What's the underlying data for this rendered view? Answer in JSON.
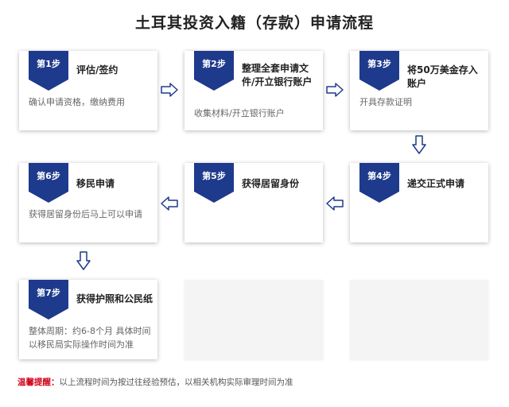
{
  "title": "土耳其投资入籍（存款）申请流程",
  "steps": [
    {
      "badge": "第1步",
      "title": "评估/签约",
      "desc": "确认申请资格，缴纳费用"
    },
    {
      "badge": "第2步",
      "title": "整理全套申请文件/开立银行账户",
      "desc": "收集材料/开立银行账户"
    },
    {
      "badge": "第3步",
      "title": "将50万美金存入账户",
      "desc": "开具存款证明"
    },
    {
      "badge": "第4步",
      "title": "递交正式申请",
      "desc": ""
    },
    {
      "badge": "第5步",
      "title": "获得居留身份",
      "desc": ""
    },
    {
      "badge": "第6步",
      "title": "移民申请",
      "desc": "获得居留身份后马上可以申请"
    },
    {
      "badge": "第7步",
      "title": "获得护照和公民纸",
      "desc": "整体周期：约6-8个月 具体时间以移民局实际操作时间为准"
    }
  ],
  "note": {
    "label": "温馨提醒：",
    "text": "以上流程时间为按过往经验预估，以相关机构实际审理时间为准"
  },
  "colors": {
    "badge": "#1e3a8c",
    "arrow": "#1e3a8c",
    "note_label": "#d0021b"
  }
}
